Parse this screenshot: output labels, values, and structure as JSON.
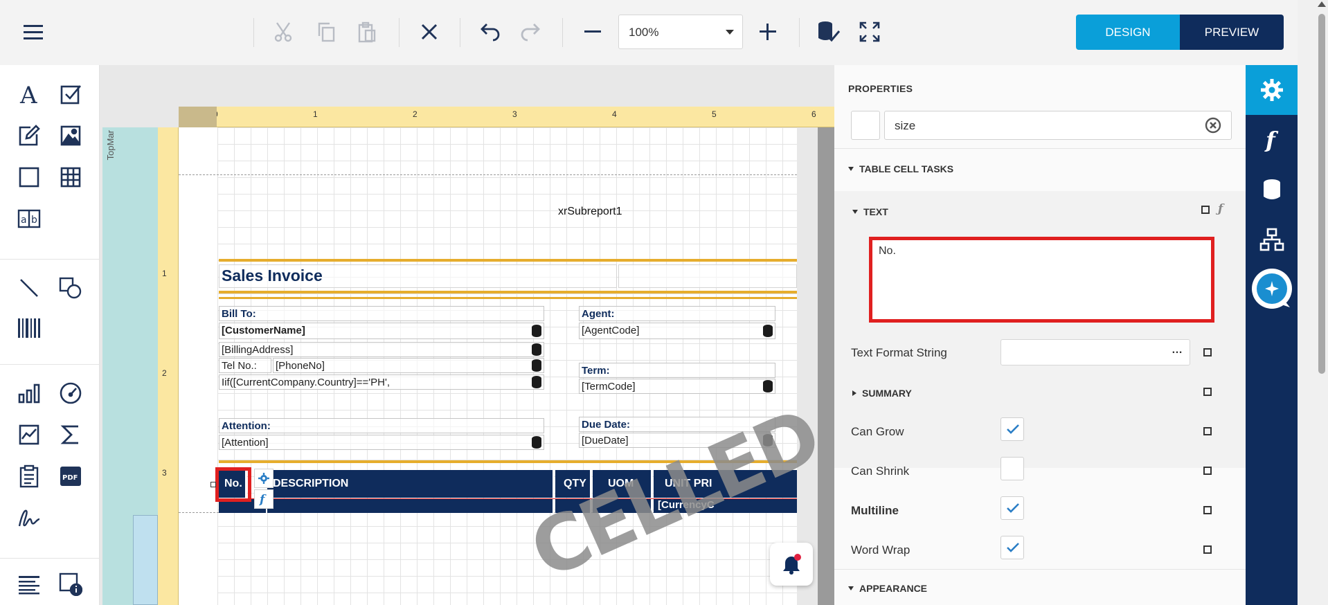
{
  "toolbar": {
    "zoom_value": "100%",
    "design_label": "DESIGN",
    "preview_label": "PREVIEW"
  },
  "surface": {
    "band_label": "TopMar",
    "ruler_top_numbers": [
      "0",
      "1",
      "2",
      "3",
      "4",
      "5",
      "6"
    ],
    "ruler_left_numbers": [
      "1",
      "2",
      "3"
    ],
    "subreport_label": "xrSubreport1",
    "invoice_title": "Sales Invoice",
    "bill_to_label": "Bill To:",
    "customer_name": "[CustomerName]",
    "billing_address": "[BillingAddress]",
    "tel_label": "Tel No.:",
    "phone": "[PhoneNo]",
    "country_expr": "Iif([CurrentCompany.Country]=='PH',",
    "attention_label": "Attention:",
    "attention_value": "[Attention]",
    "agent_label": "Agent:",
    "agent_code": "[AgentCode]",
    "term_label": "Term:",
    "term_code": "[TermCode]",
    "due_date_label": "Due Date:",
    "due_date": "[DueDate]",
    "table_headers": [
      "No.",
      "DESCRIPTION",
      "QTY",
      "UOM",
      "UNIT PRI"
    ],
    "currency_cell": "[CurrencyC",
    "watermark": "CELLED"
  },
  "properties": {
    "title": "PROPERTIES",
    "search_value": "size",
    "table_cell_tasks": "TABLE CELL TASKS",
    "text_section": "TEXT",
    "text_value": "No.",
    "text_format_label": "Text Format String",
    "text_format_btn": "…",
    "summary_label": "SUMMARY",
    "can_grow_label": "Can Grow",
    "can_shrink_label": "Can Shrink",
    "multiline_label": "Multiline",
    "word_wrap_label": "Word Wrap",
    "appearance_label": "APPEARANCE",
    "checkbox_states": {
      "can_grow": true,
      "can_shrink": false,
      "multiline": true,
      "word_wrap": true
    }
  },
  "colors": {
    "brand_navy": "#0f2c5c",
    "accent_blue": "#0a9fd9",
    "gold": "#e6ad2d",
    "highlight_red": "#e02020"
  }
}
